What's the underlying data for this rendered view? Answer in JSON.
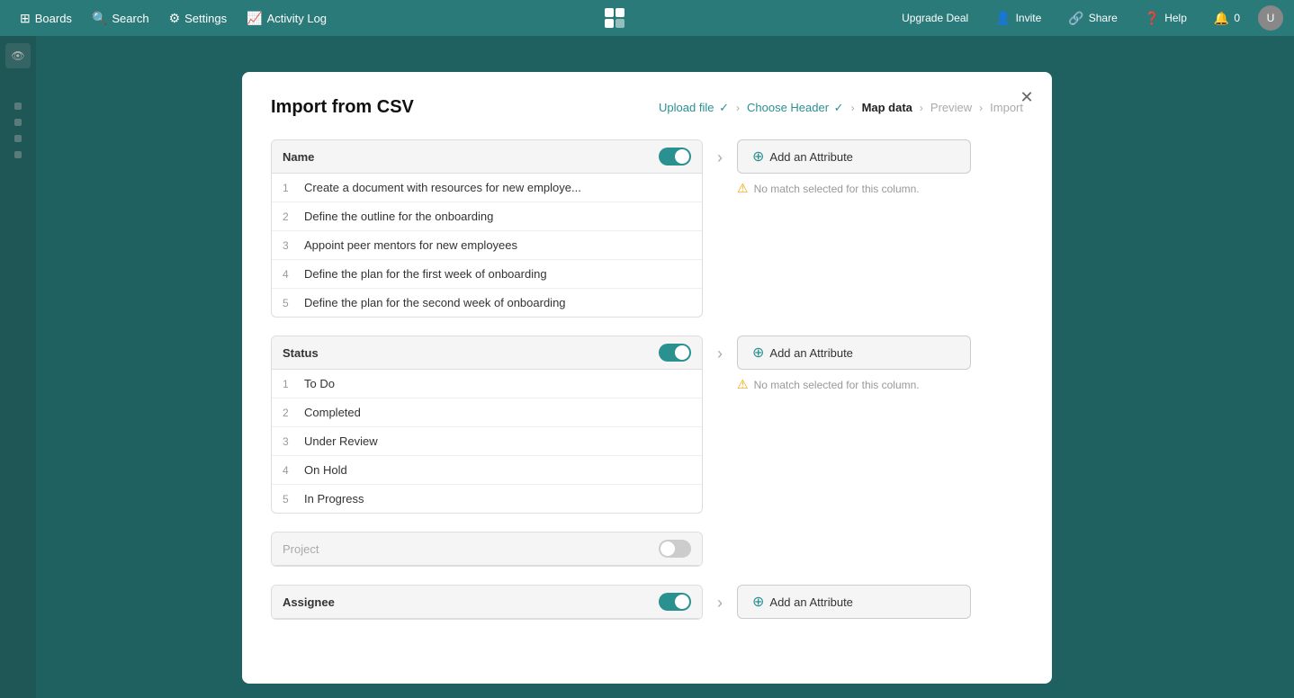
{
  "topnav": {
    "boards_label": "Boards",
    "search_label": "Search",
    "settings_label": "Settings",
    "activity_log_label": "Activity Log",
    "upgrade_deal_label": "Upgrade Deal",
    "invite_label": "Invite",
    "share_label": "Share",
    "help_label": "Help",
    "notifications_label": "0"
  },
  "modal": {
    "title": "Import from CSV",
    "breadcrumb": {
      "upload_file": "Upload file",
      "choose_header": "Choose Header",
      "map_data": "Map data",
      "preview": "Preview",
      "import": "Import"
    }
  },
  "name_column": {
    "header": "Name",
    "enabled": true,
    "rows": [
      {
        "num": "1",
        "text": "Create a document with resources for new employe..."
      },
      {
        "num": "2",
        "text": "Define the outline for the onboarding"
      },
      {
        "num": "3",
        "text": "Appoint peer mentors for new employees"
      },
      {
        "num": "4",
        "text": "Define the plan for the first week of onboarding"
      },
      {
        "num": "5",
        "text": "Define the plan for the second week of onboarding"
      }
    ]
  },
  "status_column": {
    "header": "Status",
    "enabled": true,
    "rows": [
      {
        "num": "1",
        "text": "To Do"
      },
      {
        "num": "2",
        "text": "Completed"
      },
      {
        "num": "3",
        "text": "Under Review"
      },
      {
        "num": "4",
        "text": "On Hold"
      },
      {
        "num": "5",
        "text": "In Progress"
      }
    ]
  },
  "project_column": {
    "header": "Project",
    "enabled": false
  },
  "assignee_column": {
    "header": "Assignee",
    "enabled": true
  },
  "attribute_panel": {
    "add_label": "Add an Attribute",
    "no_match": "No match selected for this column."
  }
}
